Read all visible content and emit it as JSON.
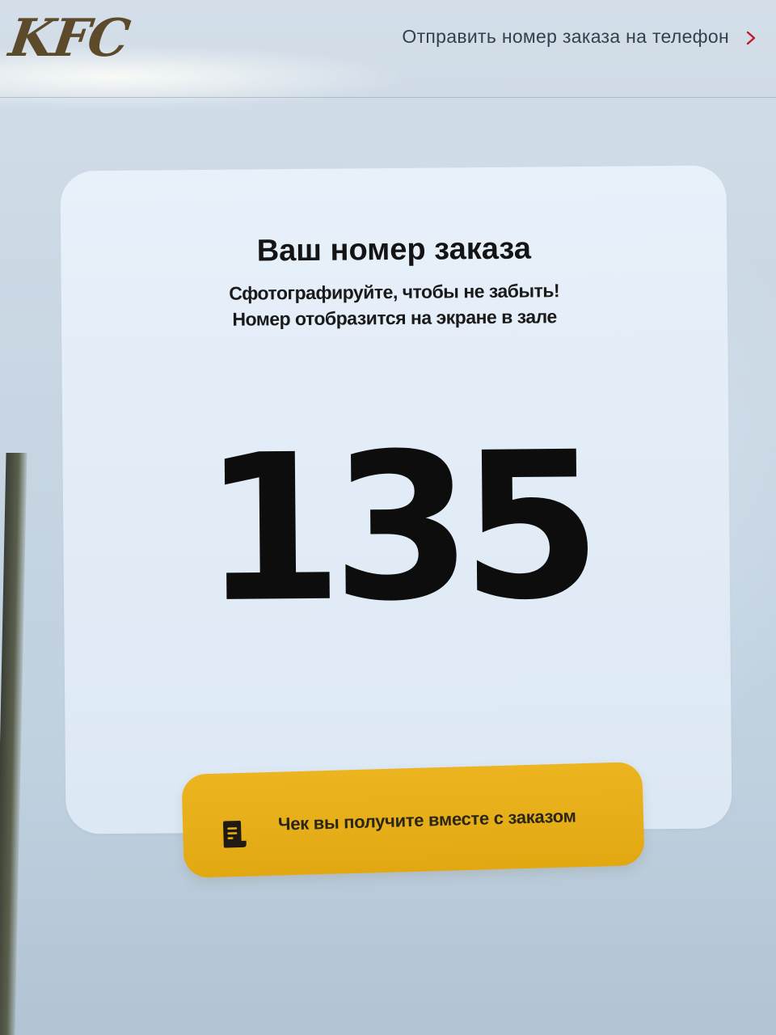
{
  "header": {
    "logo_text": "KFC",
    "send_link_label": "Отправить номер заказа на телефон"
  },
  "card": {
    "title": "Ваш номер заказа",
    "subtitle_line1": "Сфотографируйте, чтобы не забыть!",
    "subtitle_line2": "Номер отобразится на экране в зале",
    "order_number": "135"
  },
  "receipt": {
    "text": "Чек вы получите вместе с заказом",
    "icon": "receipt-icon"
  },
  "colors": {
    "accent_yellow": "#e4aa16",
    "link_chevron": "#c0182a",
    "text_dark": "#141414"
  }
}
